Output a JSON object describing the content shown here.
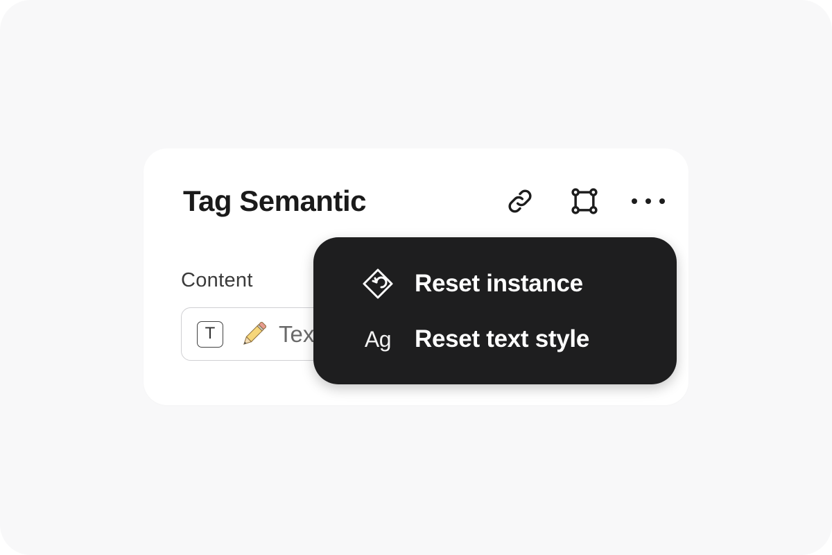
{
  "panel": {
    "title": "Tag Semantic",
    "actions": [
      {
        "icon": "link-icon"
      },
      {
        "icon": "frame-icon"
      },
      {
        "icon": "more-icon"
      }
    ]
  },
  "content": {
    "label": "Content",
    "field_value": "Text",
    "field_icons": [
      "text-type-icon",
      "pencil-icon"
    ],
    "text_type_glyph": "T"
  },
  "menu": {
    "items": [
      {
        "label": "Reset instance",
        "icon": "reset-instance-icon"
      },
      {
        "label": "Reset text style",
        "icon": "text-style-icon",
        "glyph": "Ag"
      }
    ]
  },
  "colors": {
    "background": "#f8f8f9",
    "panel": "#ffffff",
    "menu_background": "#1e1e1f",
    "menu_text": "#ffffff",
    "title_text": "#1a1a1a"
  }
}
